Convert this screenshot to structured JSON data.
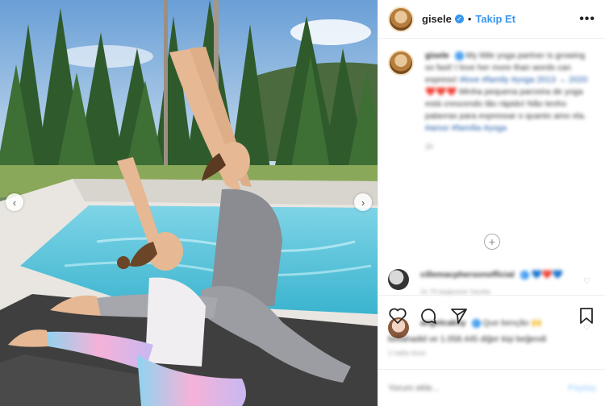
{
  "post": {
    "username": "gisele",
    "verified_mark": "✓",
    "separator": "•",
    "follow_label": "Takip Et",
    "more_label": "•••"
  },
  "caption": {
    "username": "gisele",
    "text_1": "My little yoga partner is growing so fast! I love her more than words can express!",
    "tag_1": "#love #family #yoga",
    "text_2": "2013 → 2020",
    "hearts": "❤️❤️❤️",
    "text_3": "Minha pequena parceira de yoga está crescendo tão rápido! Não tenho palavras para expressar o quanto amo ela.",
    "tag_2": "#amor #família #yoga",
    "time": "2h"
  },
  "load_more_label": "+",
  "comments": [
    {
      "username": "cillemacphersonofficial",
      "text": "💙❤️💙",
      "meta": "2s   75 beğenme   Yanıtla"
    },
    {
      "username": "angelcakey",
      "text": "Que benção 🙌",
      "meta": ""
    }
  ],
  "likes": {
    "text": "bellahadid ve 1.058.445 diğer kişi beğendi"
  },
  "post_date": "1 hafta önce",
  "add_comment": {
    "placeholder": "Yorum ekle...",
    "post_label": "Paylaş"
  },
  "icons": [
    "heart-icon",
    "comment-icon",
    "share-icon",
    "bookmark-icon",
    "chevron-left-icon",
    "chevron-right-icon",
    "verified-icon",
    "plus-circle-icon"
  ],
  "colors": {
    "accent": "#3897f0",
    "text": "#262626",
    "muted": "#999999",
    "border": "#efefef"
  }
}
